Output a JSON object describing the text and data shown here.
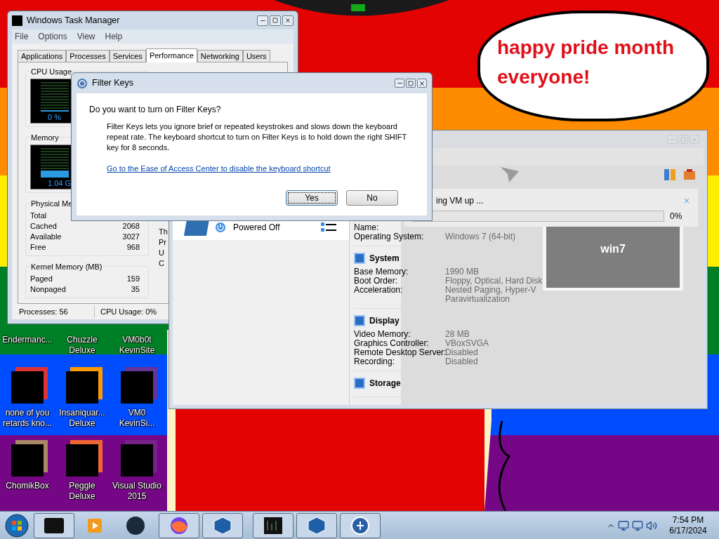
{
  "speech_bubble": {
    "text": "happy pride month everyone!"
  },
  "desktop_icons": [
    {
      "label": "Endermanc..."
    },
    {
      "label": "Chuzzle Deluxe"
    },
    {
      "label": "VM0b0t KevinSite"
    },
    {
      "label": "none of you retards kno..."
    },
    {
      "label": "Insaniquar... Deluxe"
    },
    {
      "label": "VM0 KevinSi..."
    },
    {
      "label": "ChomikBox"
    },
    {
      "label": "Peggle Deluxe"
    },
    {
      "label": "Visual Studio 2015"
    }
  ],
  "task_manager": {
    "title": "Windows Task Manager",
    "menu": [
      "File",
      "Options",
      "View",
      "Help"
    ],
    "tabs": [
      {
        "label": "Applications",
        "selected": false
      },
      {
        "label": "Processes",
        "selected": false
      },
      {
        "label": "Services",
        "selected": false
      },
      {
        "label": "Performance",
        "selected": true
      },
      {
        "label": "Networking",
        "selected": false
      },
      {
        "label": "Users",
        "selected": false
      }
    ],
    "cpu_usage": {
      "label": "CPU Usage",
      "reading": "0 %"
    },
    "memory": {
      "label": "Memory",
      "reading": "1.04 G"
    },
    "physical_memory": {
      "label": "Physical Me",
      "rows": [
        {
          "name": "Total"
        },
        {
          "name": "Cached",
          "value": "2068"
        },
        {
          "name": "Available",
          "value": "3027"
        },
        {
          "name": "Free",
          "value": "968"
        }
      ]
    },
    "kernel_memory": {
      "label": "Kernel Memory (MB)",
      "rows": [
        {
          "name": "Paged",
          "value": "159"
        },
        {
          "name": "Nonpaged",
          "value": "35"
        }
      ]
    },
    "system_column": [
      "Th",
      "Pr",
      "U",
      "C"
    ],
    "status_bar": [
      "Processes: 56",
      "CPU Usage: 0%"
    ]
  },
  "virtualbox": {
    "vm_list": [
      {
        "state": "Powered Off"
      }
    ],
    "details": [
      {
        "rows": [
          {
            "label": "Name:"
          },
          {
            "label": "Operating System:",
            "value": "Windows 7 (64-bit)"
          }
        ]
      },
      {
        "title": "System",
        "rows": [
          {
            "label": "Base Memory:",
            "value": "1990 MB"
          },
          {
            "label": "Boot Order:",
            "value": "Floppy, Optical, Hard Disk"
          },
          {
            "label": "Acceleration:",
            "value": "Nested Paging, Hyper-V Paravirtualization"
          }
        ]
      },
      {
        "title": "Display",
        "rows": [
          {
            "label": "Video Memory:",
            "value": "28 MB"
          },
          {
            "label": "Graphics Controller:",
            "value": "VBoxSVGA"
          },
          {
            "label": "Remote Desktop Server:",
            "value": "Disabled"
          },
          {
            "label": "Recording:",
            "value": "Disabled"
          }
        ]
      },
      {
        "title": "Storage"
      }
    ],
    "preview": {
      "text": "win7"
    },
    "progress": {
      "text": "ing VM up ...",
      "level": 0,
      "reading": "0%"
    }
  },
  "filter_keys": {
    "title": "Filter Keys",
    "question": "Do you want to turn on Filter Keys?",
    "body": "Filter Keys lets you ignore brief or repeated keystrokes and slows down the keyboard repeat rate.  The keyboard shortcut to turn on Filter Keys is to hold down the right SHIFT key for 8 seconds.",
    "link": "Go to the Ease of Access Center to disable the keyboard shortcut",
    "buttons": [
      {
        "label": "Yes",
        "focused": true
      },
      {
        "label": "No",
        "focused": false
      }
    ]
  },
  "taskbar": {
    "time": "7:54 PM",
    "date": "6/17/2024"
  }
}
